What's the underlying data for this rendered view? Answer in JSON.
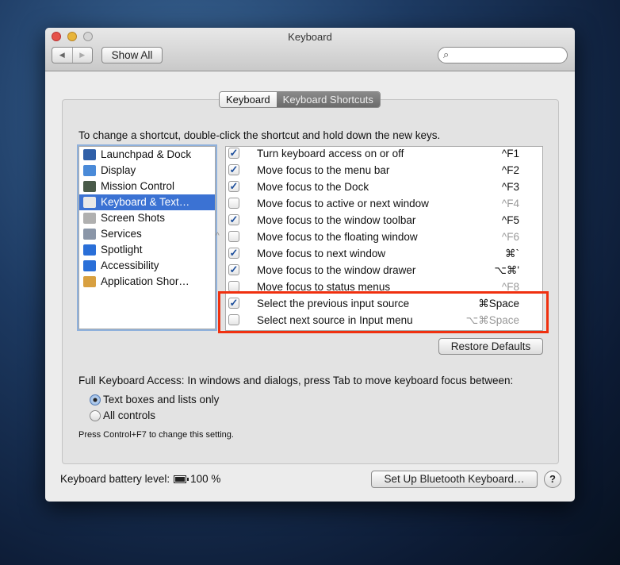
{
  "window": {
    "title": "Keyboard"
  },
  "toolbar": {
    "back_label": "◀",
    "forward_label": "▶",
    "show_all": "Show All",
    "search_placeholder": ""
  },
  "tabs": [
    {
      "label": "Keyboard",
      "selected": false
    },
    {
      "label": "Keyboard Shortcuts",
      "selected": true
    }
  ],
  "instructions": "To change a shortcut, double-click the shortcut and hold down the new keys.",
  "sidebar": {
    "items": [
      {
        "label": "Launchpad & Dock",
        "icon": "launchpad-dock-icon",
        "color": "#2f5fa8"
      },
      {
        "label": "Display",
        "icon": "display-icon",
        "color": "#4a8ad8"
      },
      {
        "label": "Mission Control",
        "icon": "mission-control-icon",
        "color": "#4a5b4a"
      },
      {
        "label": "Keyboard & Text…",
        "icon": "keyboard-icon",
        "color": "#e8e8e8",
        "selected": true
      },
      {
        "label": "Screen Shots",
        "icon": "screenshot-icon",
        "color": "#b0b0b0"
      },
      {
        "label": "Services",
        "icon": "gear-icon",
        "color": "#8a96a8"
      },
      {
        "label": "Spotlight",
        "icon": "spotlight-icon",
        "color": "#2a6fd8"
      },
      {
        "label": "Accessibility",
        "icon": "accessibility-icon",
        "color": "#2a6fd8"
      },
      {
        "label": "Application Shor…",
        "icon": "app-shortcuts-icon",
        "color": "#d8a040"
      }
    ]
  },
  "shortcuts": [
    {
      "label": "Turn keyboard access on or off",
      "key": "^F1",
      "checked": true
    },
    {
      "label": "Move focus to the menu bar",
      "key": "^F2",
      "checked": true
    },
    {
      "label": "Move focus to the Dock",
      "key": "^F3",
      "checked": true
    },
    {
      "label": "Move focus to active or next window",
      "key": "^F4",
      "checked": false
    },
    {
      "label": "Move focus to the window toolbar",
      "key": "^F5",
      "checked": true
    },
    {
      "label": "Move focus to the floating window",
      "key": "^F6",
      "checked": false
    },
    {
      "label": "Move focus to next window",
      "key": "⌘`",
      "checked": true
    },
    {
      "label": "Move focus to the window drawer",
      "key": "⌥⌘'",
      "checked": true
    },
    {
      "label": "Move focus to status menus",
      "key": "^F8",
      "checked": false
    },
    {
      "label": "Select the previous input source",
      "key": "⌘Space",
      "checked": true
    },
    {
      "label": "Select next source in Input menu",
      "key": "⌥⌘Space",
      "checked": false
    }
  ],
  "restore_defaults": "Restore Defaults",
  "full_access": {
    "label": "Full Keyboard Access: In windows and dialogs, press Tab to move keyboard focus between:",
    "options": [
      {
        "label": "Text boxes and lists only",
        "selected": true
      },
      {
        "label": "All controls",
        "selected": false
      }
    ],
    "hint": "Press Control+F7 to change this setting."
  },
  "battery": {
    "label": "Keyboard battery level:",
    "value": "100 %",
    "level": 1.0
  },
  "bluetooth_button": "Set Up Bluetooth Keyboard…",
  "help_label": "?",
  "highlight_color": "#f0300f"
}
